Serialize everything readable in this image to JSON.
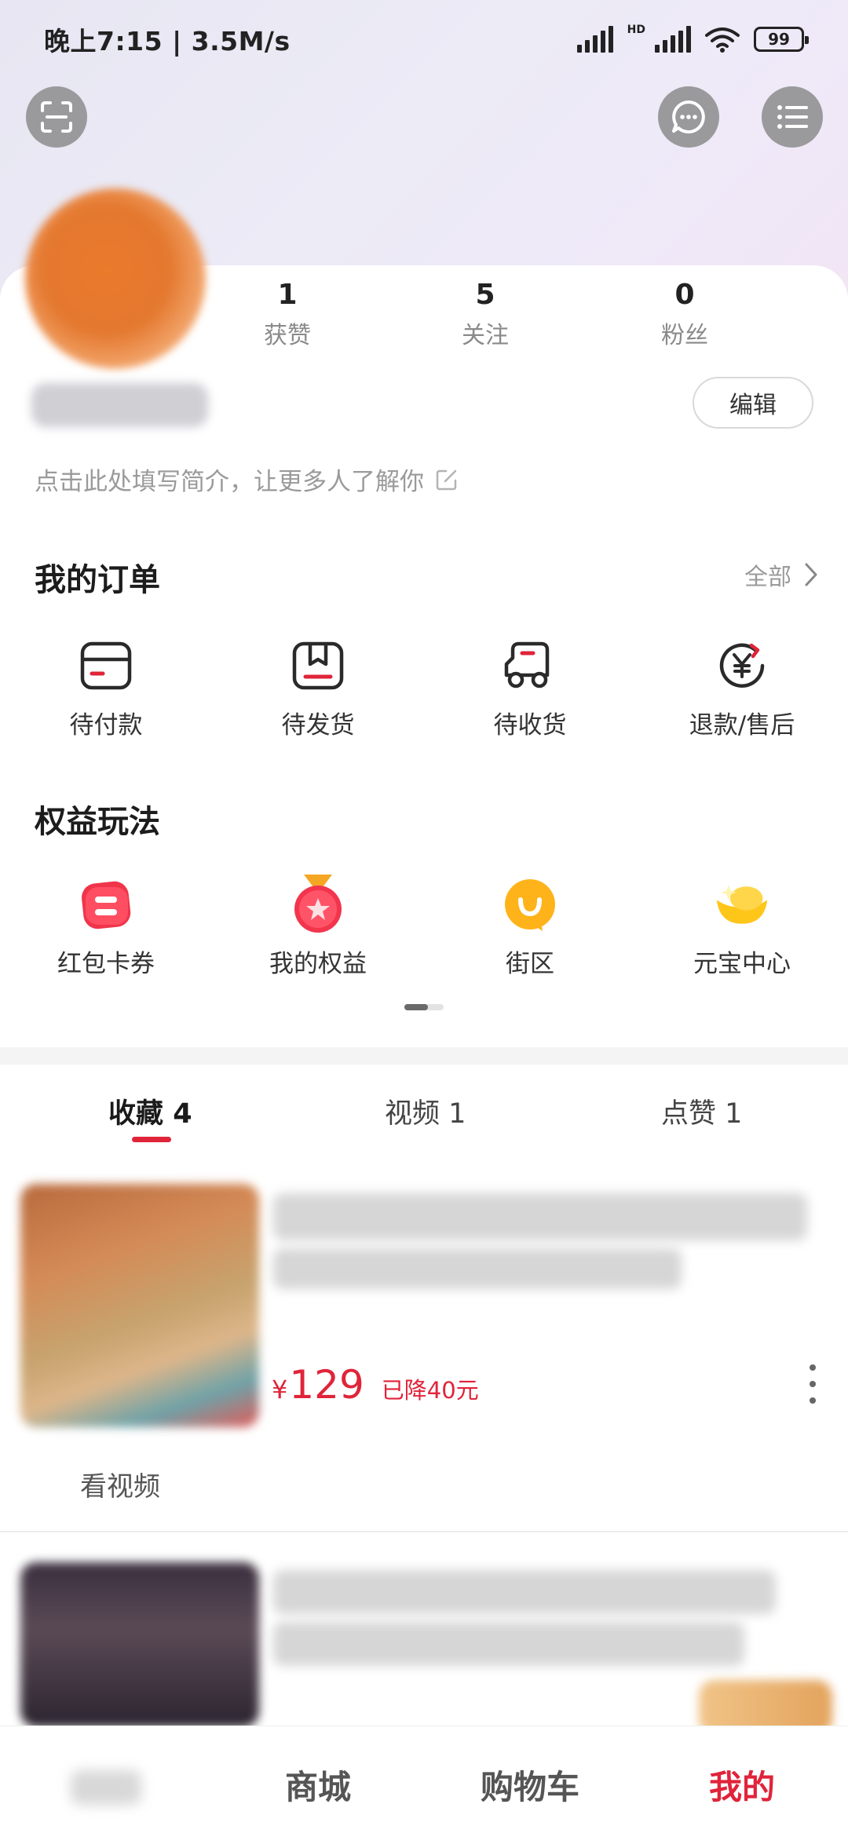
{
  "status_bar": {
    "time_speed": "晚上7:15 | 3.5M/s",
    "hd": "HD",
    "battery": "99"
  },
  "top_actions": {
    "scan_icon": "scan-icon",
    "message_icon": "chat-bubble-icon",
    "menu_icon": "menu-list-icon"
  },
  "profile": {
    "stats": [
      {
        "num": "1",
        "label": "获赞"
      },
      {
        "num": "5",
        "label": "关注"
      },
      {
        "num": "0",
        "label": "粉丝"
      }
    ],
    "edit_label": "编辑",
    "bio_placeholder": "点击此处填写简介，让更多人了解你"
  },
  "orders": {
    "title": "我的订单",
    "all_label": "全部",
    "items": [
      {
        "label": "待付款",
        "icon": "wallet-icon"
      },
      {
        "label": "待发货",
        "icon": "package-icon"
      },
      {
        "label": "待收货",
        "icon": "truck-icon"
      },
      {
        "label": "退款/售后",
        "icon": "yuan-refund-icon"
      }
    ]
  },
  "benefits": {
    "title": "权益玩法",
    "items": [
      {
        "label": "红包卡券",
        "icon": "red-packet-icon"
      },
      {
        "label": "我的权益",
        "icon": "medal-icon"
      },
      {
        "label": "街区",
        "icon": "smile-bubble-icon"
      },
      {
        "label": "元宝中心",
        "icon": "gold-ingot-icon"
      }
    ]
  },
  "tabs": [
    {
      "label": "收藏",
      "count": "4",
      "active": true
    },
    {
      "label": "视频 1",
      "active": false
    },
    {
      "label": "点赞 1",
      "active": false
    }
  ],
  "favorites": [
    {
      "price_symbol": "¥",
      "price": "129",
      "price_drop": "已降40元",
      "action": "看视频"
    }
  ],
  "bottom_nav": {
    "items": [
      {
        "label": "商城",
        "active": false
      },
      {
        "label": "购物车",
        "active": false
      },
      {
        "label": "我的",
        "active": true
      }
    ]
  },
  "colors": {
    "accent": "#e0243a",
    "text_secondary": "#9a9a9a"
  }
}
